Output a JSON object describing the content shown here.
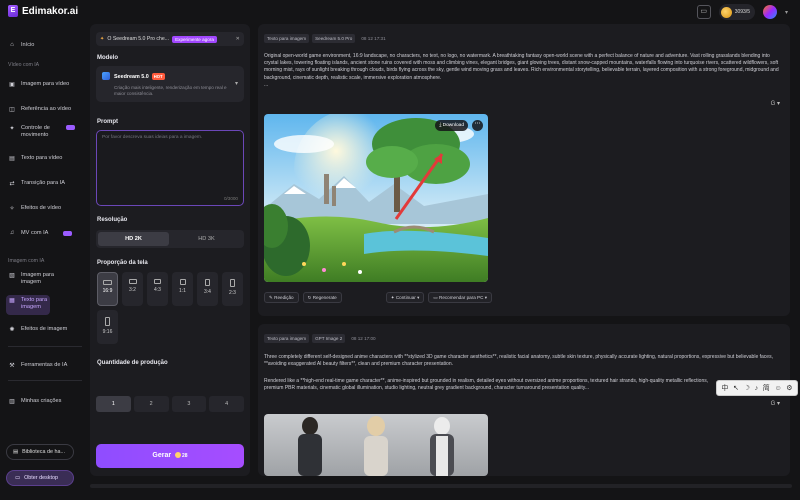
{
  "app": {
    "name": "Edimakor.ai",
    "logo_letter": "E",
    "credits": "3093/5",
    "accent": "#9b5cff"
  },
  "sidebar": {
    "home": "Início",
    "section_video": "Vídeo com IA",
    "video_items": [
      "Imagem para vídeo",
      "Referência ao vídeo",
      "Controle de movimento",
      "Texto para vídeo",
      "Transição para IA",
      "Efeitos de vídeo",
      "MV com IA"
    ],
    "section_image": "Imagem com IA",
    "image_items": [
      "Imagem para imagem",
      "Texto para imagem",
      "Efeitos de imagem"
    ],
    "tools": "Ferramentas de IA",
    "creations": "Minhas criações",
    "library_button": "Biblioteca de ha...",
    "desktop_button": "Obter desktop"
  },
  "panel": {
    "banner_text": "O Seedream 5.0 Pro che...",
    "banner_badge": "Experimente agora",
    "model_label": "Modelo",
    "model_name": "Seedream 5.0",
    "model_hot": "HOT",
    "model_desc": "Criação mais inteligente, renderização em tempo real e maior consistência.",
    "prompt_label": "Prompt",
    "prompt_placeholder": "Por favor descreva suas ideias para a imagem.",
    "prompt_count": "0/3000",
    "resolution_label": "Resolução",
    "resolutions": [
      "HD 2K",
      "HD 3K"
    ],
    "ratio_label": "Proporção da tela",
    "ratios": [
      "16:9",
      "3:2",
      "4:3",
      "1:1",
      "3:4",
      "2:3",
      "9:16"
    ],
    "quantity_label": "Quantidade de produção",
    "quantities": [
      "1",
      "2",
      "3",
      "4"
    ],
    "generate_label": "Gerar",
    "generate_cost": "28"
  },
  "results": [
    {
      "tags": [
        "Texto para imagem",
        "Seedream 5.0 Pro"
      ],
      "time": "08 12 17:31",
      "description": "Original open-world game environment, 16:9 landscape, no characters, no text, no logo, no watermark. A breathtaking fantasy open-world scene with a perfect balance of nature and adventure. Vast rolling grasslands blending into crystal lakes, towering floating islands, ancient stone ruins covered with moss and climbing vines, elegant bridges, giant glowing trees, distant snow-capped mountains, waterfalls flowing into turquoise rivers, scattered wildflowers, soft morning mist, rays of sunlight breaking through clouds, birds flying across the sky, gentle wind moving grass and leaves. Rich environmental storytelling, believable terrain, layered composition with a strong foreground, midground and background, cinematic depth, realistic scale, immersive exploration atmosphere.",
      "ellipsis": "...",
      "download_label": "Download",
      "actions": [
        "Reedição",
        "Regenerate",
        "Continuar",
        "Recomendar para PC"
      ]
    },
    {
      "tags": [
        "Texto para imagem",
        "GPT Image 2"
      ],
      "time": "08 12 17:00",
      "description_1": "Three completely different self-designed anime characters with **stylized 3D game character aesthetics**, realistic facial anatomy, subtle skin texture, physically accurate lighting, natural proportions, expressive but believable faces, **avoiding exaggerated AI beauty filters**, clean and premium character presentation.",
      "description_2": "Rendered like a **high-end real-time game character**, anime-inspired but grounded in realism, detailed eyes without oversized anime proportions, textured hair strands, high-quality metallic reflections, premium PBR materials, cinematic global illumination, studio lighting, neutral grey gradient background, character turnaround presentation quality..."
    }
  ],
  "floating_toolbar": {
    "items": [
      "中",
      "↖",
      "☽",
      "♪",
      "简",
      "☺",
      "⚙"
    ]
  }
}
